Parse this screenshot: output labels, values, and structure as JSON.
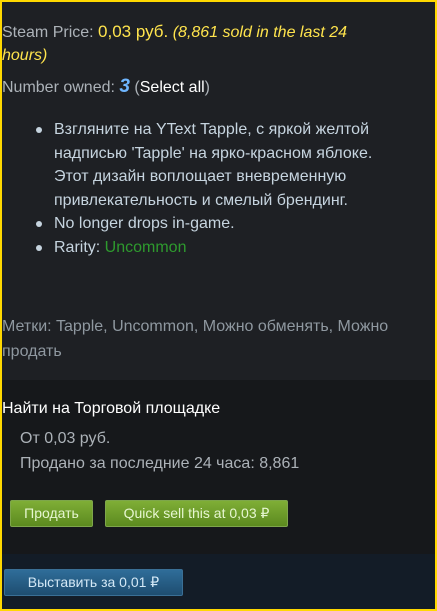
{
  "price": {
    "label": "Steam Price: ",
    "value": "0,03 руб.",
    "note_part1": "(8,861 sold in the last 24",
    "note_part2": "hours)"
  },
  "owned": {
    "label": "Number owned: ",
    "count": "3",
    "open_paren": " (",
    "select_all": "Select all",
    "close_paren": ")"
  },
  "description": {
    "bullet1": "Взгляните на YText Tapple, с яркой желтой надписью 'Tapple' на ярко-красном яблоке. Этот дизайн воплощает вневременную привлекательность и смелый брендинг.",
    "bullet2": "No longer drops in-game.",
    "rarity_label": "Rarity: ",
    "rarity_value": "Uncommon"
  },
  "tags": "Метки: Tapple, Uncommon, Можно обменять, Можно продать",
  "market": {
    "title": "Найти на Торговой площадке",
    "from": "От 0,03 руб.",
    "sold": "Продано за последние 24 часа: 8,861",
    "sell_button": "Продать",
    "quick_sell_button": "Quick sell this at 0,03 ₽"
  },
  "list_button": "Выставить за 0,01 ₽",
  "colors": {
    "frame_border": "#ffd800",
    "price": "#ffe44d",
    "owned_count": "#6fb6ff",
    "rarity_uncommon": "#2e9a2e",
    "green_button": "#5c8a1f",
    "blue_button": "#1e4d70"
  }
}
